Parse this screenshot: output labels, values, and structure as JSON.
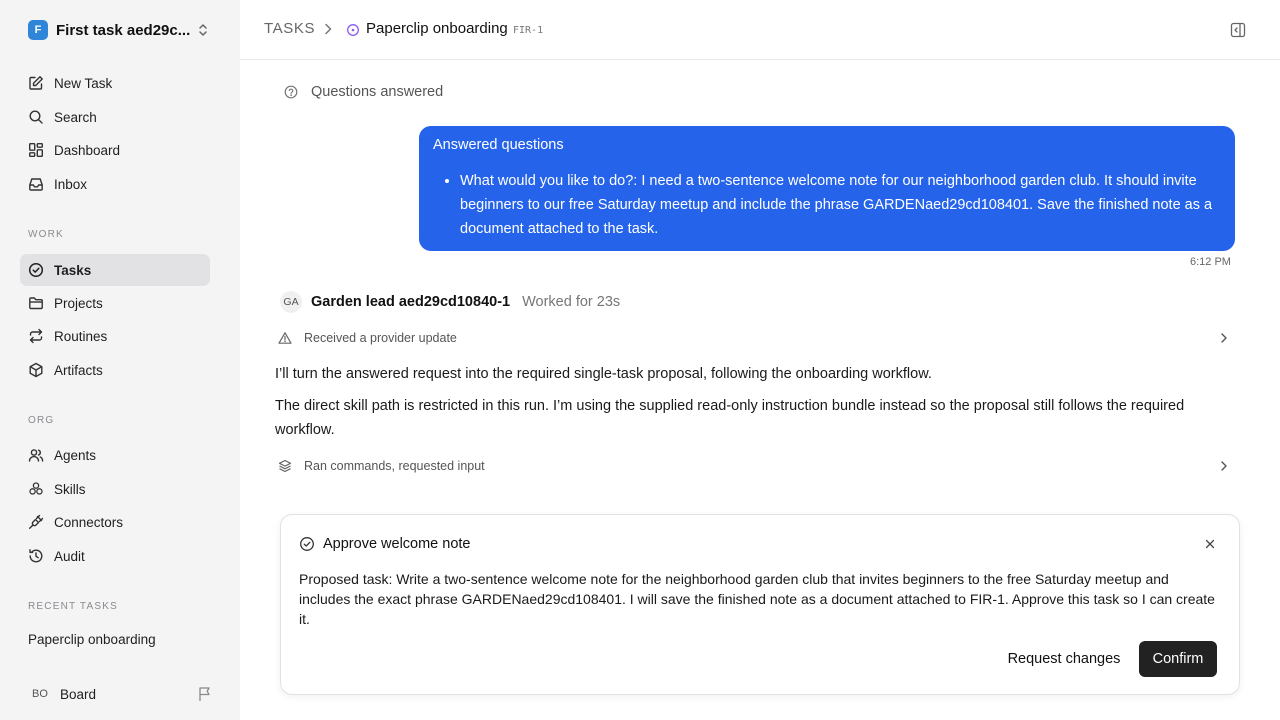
{
  "workspace": {
    "logo": "F",
    "name": "First task aed29c..."
  },
  "sidebar": {
    "nav": [
      {
        "label": "New Task",
        "icon": "edit-icon"
      },
      {
        "label": "Search",
        "icon": "search-icon"
      },
      {
        "label": "Dashboard",
        "icon": "dashboard-icon"
      },
      {
        "label": "Inbox",
        "icon": "inbox-icon"
      }
    ],
    "work_heading": "WORK",
    "work": [
      {
        "label": "Tasks",
        "icon": "check-circle-icon",
        "active": true
      },
      {
        "label": "Projects",
        "icon": "folder-icon"
      },
      {
        "label": "Routines",
        "icon": "repeat-icon"
      },
      {
        "label": "Artifacts",
        "icon": "box-icon"
      }
    ],
    "org_heading": "ORG",
    "org": [
      {
        "label": "Agents",
        "icon": "users-icon"
      },
      {
        "label": "Skills",
        "icon": "skills-icon"
      },
      {
        "label": "Connectors",
        "icon": "plug-icon"
      },
      {
        "label": "Audit",
        "icon": "history-icon"
      }
    ],
    "recent_heading": "RECENT TASKS",
    "recent": [
      "Paperclip onboarding"
    ],
    "user": {
      "initials": "BO",
      "name": "Board"
    }
  },
  "header": {
    "root": "TASKS",
    "title": "Paperclip onboarding",
    "id": "FIR-1"
  },
  "thread": {
    "questions_label": "Questions answered",
    "bubble": {
      "title": "Answered questions",
      "item": "What would you like to do?: I need a two-sentence welcome note for our neighborhood garden club. It should invite beginners to our free Saturday meetup and include the phrase GARDENaed29cd108401. Save the finished note as a document attached to the task."
    },
    "time": "6:12 PM",
    "agent": {
      "initials": "GA",
      "name": "Garden lead aed29cd10840-1",
      "worked": "Worked for 23s"
    },
    "event1": "Received a provider update",
    "message1": "I’ll turn the answered request into the required single-task proposal, following the onboarding workflow.",
    "message2": "The direct skill path is restricted in this run. I’m using the supplied read-only instruction bundle instead so the proposal still follows the required workflow.",
    "event2": "Ran commands, requested input"
  },
  "approval": {
    "title": "Approve welcome note",
    "body": "Proposed task: Write a two-sentence welcome note for the neighborhood garden club that invites beginners to the free Saturday meetup and includes the exact phrase GARDENaed29cd108401. I will save the finished note as a document attached to FIR-1. Approve this task so I can create it.",
    "request_changes": "Request changes",
    "confirm": "Confirm"
  },
  "colors": {
    "accent": "#2563eb",
    "sidebar_bg": "#f4f4f5",
    "confirm_bg": "#222222",
    "status_purple": "#8b5cf6"
  }
}
